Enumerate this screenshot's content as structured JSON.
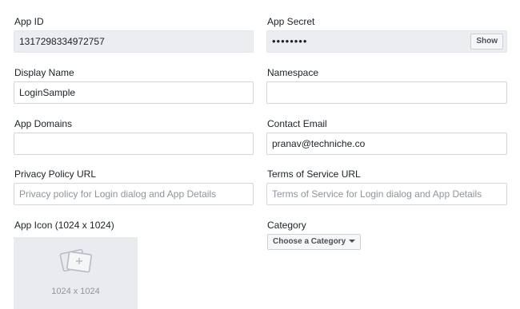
{
  "fields": {
    "app_id": {
      "label": "App ID",
      "value": "1317298334972757"
    },
    "app_secret": {
      "label": "App Secret",
      "value": "••••••••",
      "show_label": "Show"
    },
    "display_name": {
      "label": "Display Name",
      "value": "LoginSample"
    },
    "namespace": {
      "label": "Namespace",
      "value": ""
    },
    "app_domains": {
      "label": "App Domains",
      "value": ""
    },
    "contact_email": {
      "label": "Contact Email",
      "value": "pranav@techniche.co"
    },
    "privacy_url": {
      "label": "Privacy Policy URL",
      "placeholder": "Privacy policy for Login dialog and App Details"
    },
    "terms_url": {
      "label": "Terms of Service URL",
      "placeholder": "Terms of Service for Login dialog and App Details"
    },
    "app_icon": {
      "label": "App Icon (1024 x 1024)",
      "size_text": "1024 x 1024"
    },
    "category": {
      "label": "Category",
      "button_label": "Choose a Category"
    }
  }
}
